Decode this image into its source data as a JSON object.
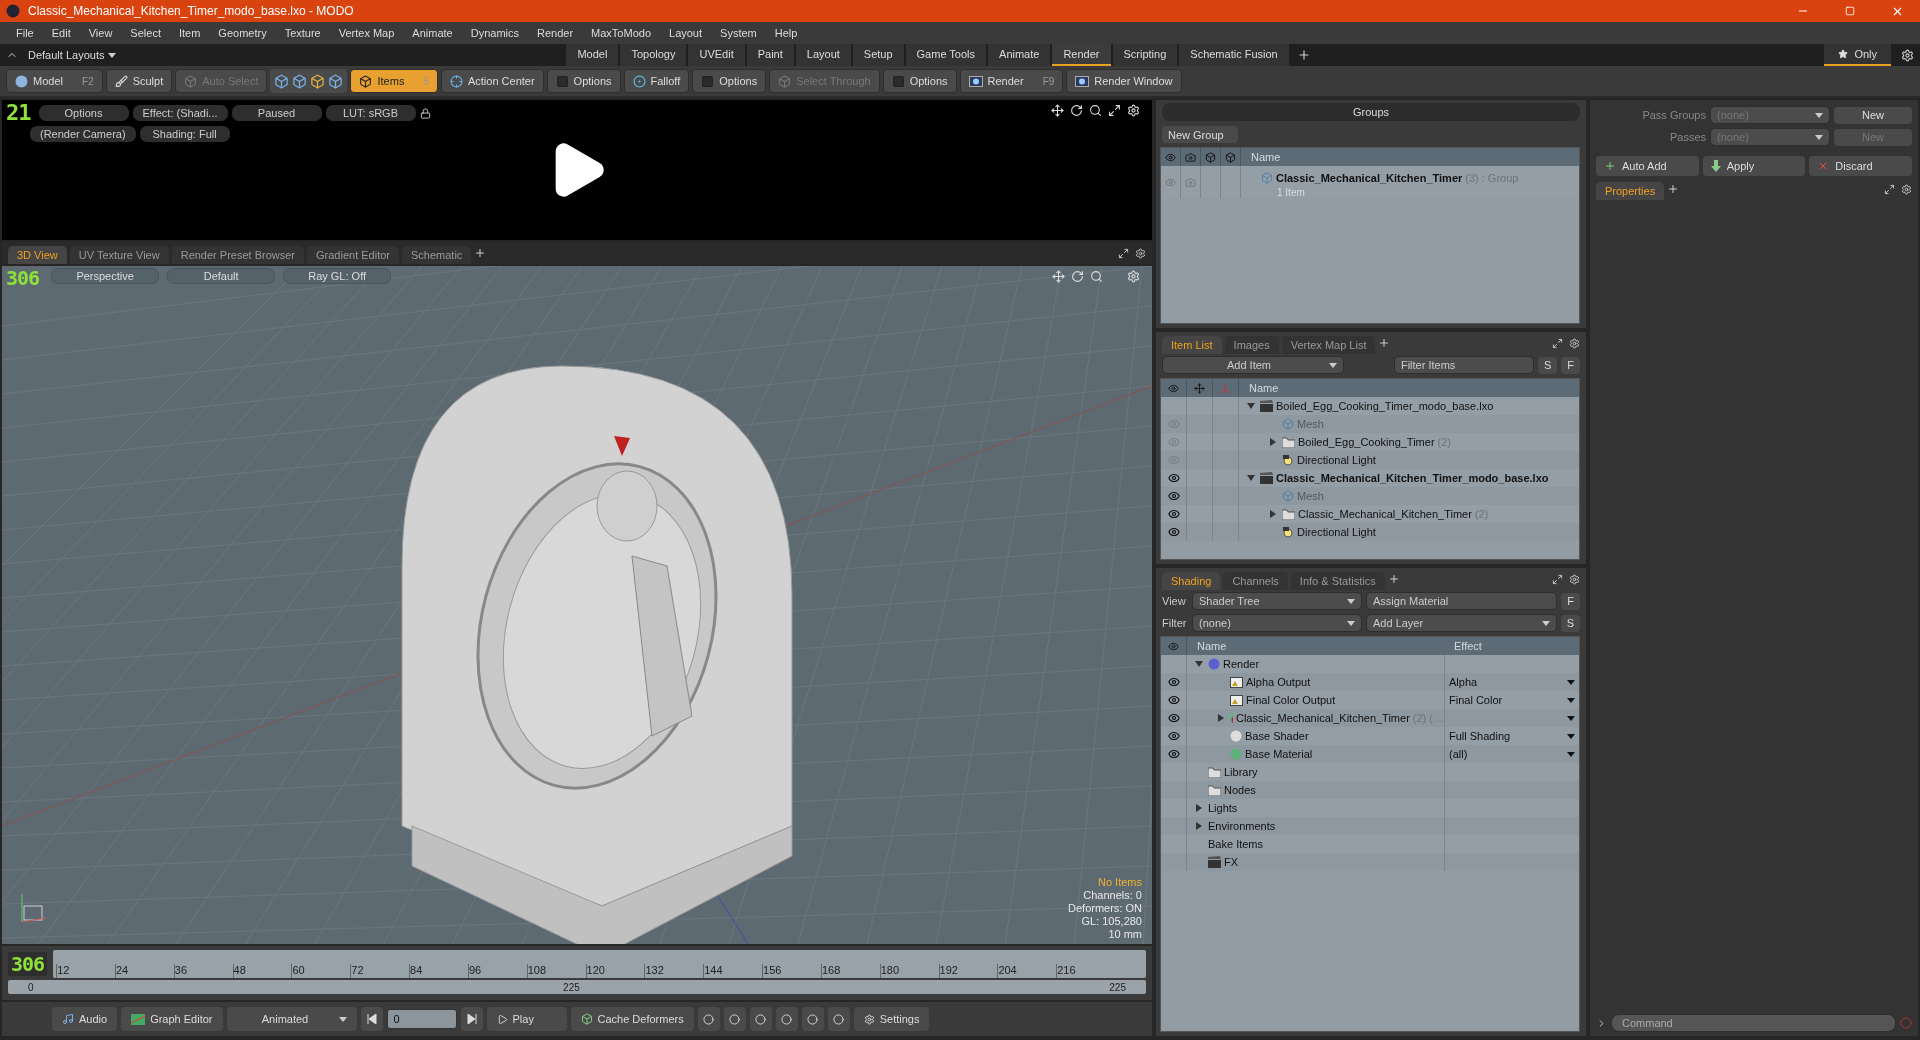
{
  "window": {
    "title": "Classic_Mechanical_Kitchen_Timer_modo_base.lxo - MODO"
  },
  "menu": [
    "File",
    "Edit",
    "View",
    "Select",
    "Item",
    "Geometry",
    "Texture",
    "Vertex Map",
    "Animate",
    "Dynamics",
    "Render",
    "MaxToModo",
    "Layout",
    "System",
    "Help"
  ],
  "layout_bar": {
    "layout": "Default Layouts",
    "tabs": [
      {
        "label": "Model",
        "selected": false
      },
      {
        "label": "Topology",
        "selected": false
      },
      {
        "label": "UVEdit",
        "selected": false
      },
      {
        "label": "Paint",
        "selected": false
      },
      {
        "label": "Layout",
        "selected": false
      },
      {
        "label": "Setup",
        "selected": false
      },
      {
        "label": "Game Tools",
        "selected": false
      },
      {
        "label": "Animate",
        "selected": false
      },
      {
        "label": "Render",
        "selected": true
      },
      {
        "label": "Scripting",
        "selected": false
      },
      {
        "label": "Schematic Fusion",
        "selected": false
      }
    ],
    "only": "Only"
  },
  "toolbar": [
    {
      "kind": "button",
      "label": "Model",
      "shortcut": "F2",
      "selected": false,
      "disabled": false
    },
    {
      "kind": "button",
      "label": "Sculpt",
      "selected": false,
      "disabled": false
    },
    {
      "kind": "button",
      "label": "Auto Select",
      "selected": false,
      "disabled": true
    },
    {
      "kind": "icon-set"
    },
    {
      "kind": "button",
      "label": "Items",
      "shortcut": "5",
      "selected": true,
      "disabled": false
    },
    {
      "kind": "button",
      "label": "Action Center",
      "selected": false,
      "disabled": false
    },
    {
      "kind": "button",
      "label": "Options",
      "selected": false,
      "disabled": false
    },
    {
      "kind": "button",
      "label": "Falloff",
      "selected": false,
      "disabled": false
    },
    {
      "kind": "button",
      "label": "Options",
      "selected": false,
      "disabled": false
    },
    {
      "kind": "button",
      "label": "Select Through",
      "selected": false,
      "disabled": true
    },
    {
      "kind": "button",
      "label": "Options",
      "selected": false,
      "disabled": false
    },
    {
      "kind": "button",
      "label": "Render",
      "shortcut": "F9",
      "selected": false,
      "disabled": false
    },
    {
      "kind": "button",
      "label": "Render Window",
      "selected": false,
      "disabled": false
    }
  ],
  "render_preview": {
    "frame": "21",
    "row_1": [
      "Options",
      "Effect: (Shadi...",
      "Paused",
      "LUT: sRGB"
    ],
    "row_2": [
      "(Render Camera)",
      "Shading: Full"
    ]
  },
  "viewport_tabs": [
    {
      "label": "3D View",
      "selected": true
    },
    {
      "label": "UV Texture View",
      "selected": false
    },
    {
      "label": "Render Preset Browser",
      "selected": false
    },
    {
      "label": "Gradient Editor",
      "selected": false
    },
    {
      "label": "Schematic",
      "selected": false
    }
  ],
  "viewport": {
    "frame": "306",
    "buttons": [
      "Perspective",
      "Default",
      "Ray GL: Off"
    ],
    "status": "No Items",
    "info": [
      "Channels: 0",
      "Deformers: ON",
      "GL: 105,280",
      "10 mm"
    ]
  },
  "timeline": {
    "frame": "306",
    "ticks": [
      "12",
      "24",
      "36",
      "48",
      "60",
      "72",
      "84",
      "96",
      "108",
      "120",
      "132",
      "144",
      "156",
      "168",
      "180",
      "192",
      "204",
      "216"
    ],
    "start": "0",
    "middle": "225",
    "end": "225"
  },
  "bottom_bar": {
    "audio": "Audio",
    "graph_editor": "Graph Editor",
    "mode": "Animated",
    "frame": "0",
    "play": "Play",
    "cache": "Cache Deformers",
    "settings": "Settings"
  },
  "groups": {
    "title": "Groups",
    "new_group": "New Group",
    "column": "Name",
    "rows": [
      {
        "name": "Classic_Mechanical_Kitchen_Timer",
        "count": "(3)",
        "type": ": Group",
        "detail": "1 Item"
      }
    ]
  },
  "passes": {
    "pass_groups_label": "Pass Groups",
    "pass_groups_value": "(none)",
    "pass_groups_new": "New",
    "passes_label": "Passes",
    "passes_value": "(none)",
    "passes_new": "New",
    "auto_add": "Auto Add",
    "apply": "Apply",
    "discard": "Discard",
    "properties_tab": "Properties"
  },
  "item_list": {
    "tabs": [
      {
        "label": "Item List",
        "selected": true
      },
      {
        "label": "Images",
        "selected": false
      },
      {
        "label": "Vertex Map List",
        "selected": false
      }
    ],
    "add_item": "Add Item",
    "filter": {
      "placeholder": "Filter Items"
    },
    "s": "S",
    "f": "F",
    "column": "Name",
    "tree": [
      {
        "kind": "scene",
        "name": "Boiled_Egg_Cooking_Timer_modo_base.lxo",
        "active": false,
        "expanded": true,
        "children": [
          {
            "kind": "mesh",
            "name": "Mesh",
            "visible": false,
            "greyed": true
          },
          {
            "kind": "folder",
            "name": "Boiled_Egg_Cooking_Timer",
            "count": "(2)",
            "visible": false,
            "greyed": false,
            "expanded": false
          },
          {
            "kind": "light",
            "name": "Directional Light",
            "visible": false,
            "greyed": false
          }
        ]
      },
      {
        "kind": "scene",
        "name": "Classic_Mechanical_Kitchen_Timer_modo_base.lxo",
        "active": true,
        "visible": true,
        "expanded": true,
        "children": [
          {
            "kind": "mesh",
            "name": "Mesh",
            "visible": true,
            "greyed": true
          },
          {
            "kind": "folder",
            "name": "Classic_Mechanical_Kitchen_Timer",
            "count": "(2)",
            "visible": true,
            "greyed": false,
            "expanded": false
          },
          {
            "kind": "light",
            "name": "Directional Light",
            "visible": true,
            "greyed": false
          }
        ]
      }
    ]
  },
  "shading": {
    "tabs": [
      {
        "label": "Shading",
        "selected": true
      },
      {
        "label": "Channels",
        "selected": false
      },
      {
        "label": "Info & Statistics",
        "selected": false
      }
    ],
    "view_label": "View",
    "view": "Shader Tree",
    "assign": "Assign Material",
    "f": "F",
    "filter_label": "Filter",
    "filter": "(none)",
    "add_layer": "Add Layer",
    "s": "S",
    "columns": [
      "Name",
      "Effect"
    ],
    "tree": [
      {
        "kind": "render",
        "name": "Render",
        "expanded": true,
        "children": [
          {
            "kind": "output",
            "name": "Alpha Output",
            "effect": "Alpha",
            "visible": true
          },
          {
            "kind": "output",
            "name": "Final Color Output",
            "effect": "Final Color",
            "visible": true
          },
          {
            "kind": "material-group",
            "name": "Classic_Mechanical_Kitchen_Timer",
            "count": "(2) (…",
            "visible": true,
            "expanded": false
          },
          {
            "kind": "shader",
            "name": "Base Shader",
            "effect": "Full Shading",
            "visible": true
          },
          {
            "kind": "material",
            "name": "Base Material",
            "effect": "(all)",
            "visible": true
          }
        ]
      },
      {
        "kind": "folder",
        "name": "Library"
      },
      {
        "kind": "folder",
        "name": "Nodes"
      },
      {
        "kind": "plain",
        "name": "Lights",
        "expanded": false
      },
      {
        "kind": "plain",
        "name": "Environments",
        "expanded": false
      },
      {
        "kind": "plain",
        "name": "Bake Items"
      },
      {
        "kind": "clapper",
        "name": "FX"
      }
    ]
  },
  "command": {
    "placeholder": "Command"
  }
}
